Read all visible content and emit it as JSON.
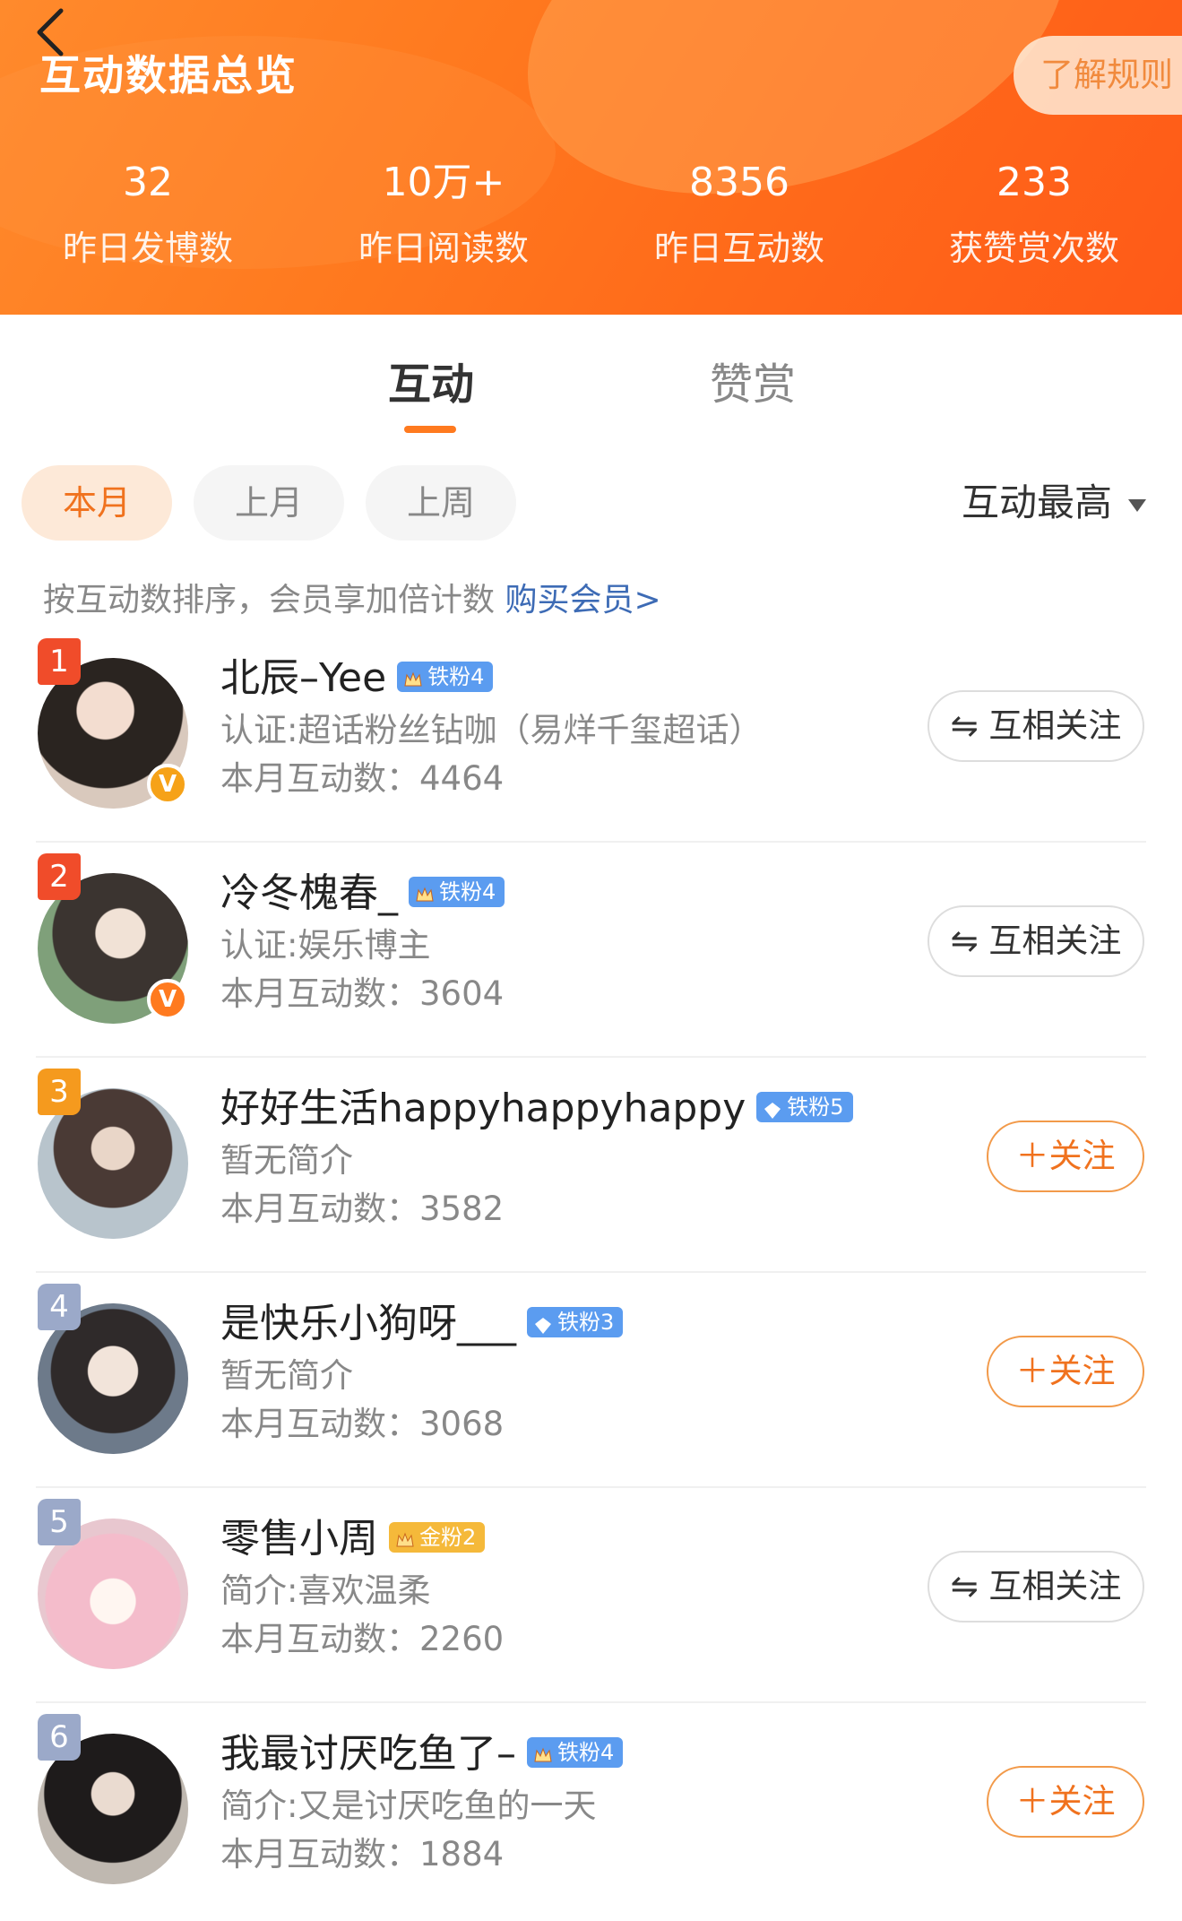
{
  "header": {
    "title": "互动数据总览",
    "rules_label": "了解规则",
    "stats": [
      {
        "value": "32",
        "label": "昨日发博数"
      },
      {
        "value": "10万+",
        "label": "昨日阅读数"
      },
      {
        "value": "8356",
        "label": "昨日互动数"
      },
      {
        "value": "233",
        "label": "获赞赏次数"
      }
    ]
  },
  "tabs": [
    {
      "label": "互动",
      "active": true
    },
    {
      "label": "赞赏",
      "active": false
    }
  ],
  "filters": {
    "periods": [
      "本月",
      "上月",
      "上周"
    ],
    "selected": "本月",
    "sort_label": "互动最高"
  },
  "hint": {
    "text": "按互动数排序，会员享加倍计数",
    "link": "购买会员>"
  },
  "colors": {
    "accent": "#ff7a1f",
    "rank_top": "#f04c2a",
    "rank_mid": "#f59a1e",
    "rank_other": "#9ba9c9"
  },
  "users": [
    {
      "rank": "1",
      "name": "北辰–Yee",
      "fan_badge": "铁粉4",
      "fan_icon": "crown-icon",
      "desc": "认证:超话粉丝钻咖（易烊千玺超话）",
      "count": "本月互动数：4464",
      "action": "⇋ 互相关注",
      "verified": "V"
    },
    {
      "rank": "2",
      "name": "冷冬槐春_",
      "fan_badge": "铁粉4",
      "fan_icon": "crown-icon",
      "desc": "认证:娱乐博主",
      "count": "本月互动数：3604",
      "action": "⇋ 互相关注",
      "verified": "V"
    },
    {
      "rank": "3",
      "name": "好好生活happyhappyhappy",
      "fan_badge": "铁粉5",
      "fan_icon": "diamond-icon",
      "desc": "暂无简介",
      "count": "本月互动数：3582",
      "action": "＋关注",
      "verified": ""
    },
    {
      "rank": "4",
      "name": "是快乐小狗呀___",
      "fan_badge": "铁粉3",
      "fan_icon": "diamond-icon",
      "desc": "暂无简介",
      "count": "本月互动数：3068",
      "action": "＋关注",
      "verified": ""
    },
    {
      "rank": "5",
      "name": "零售小周",
      "fan_badge": "金粉2",
      "fan_icon": "crown-icon",
      "desc": "简介:喜欢温柔",
      "count": "本月互动数：2260",
      "action": "⇋ 互相关注",
      "verified": ""
    },
    {
      "rank": "6",
      "name": "我最讨厌吃鱼了–",
      "fan_badge": "铁粉4",
      "fan_icon": "crown-icon",
      "desc": "简介:又是讨厌吃鱼的一天",
      "count": "本月互动数：1884",
      "action": "＋关注",
      "verified": ""
    }
  ]
}
